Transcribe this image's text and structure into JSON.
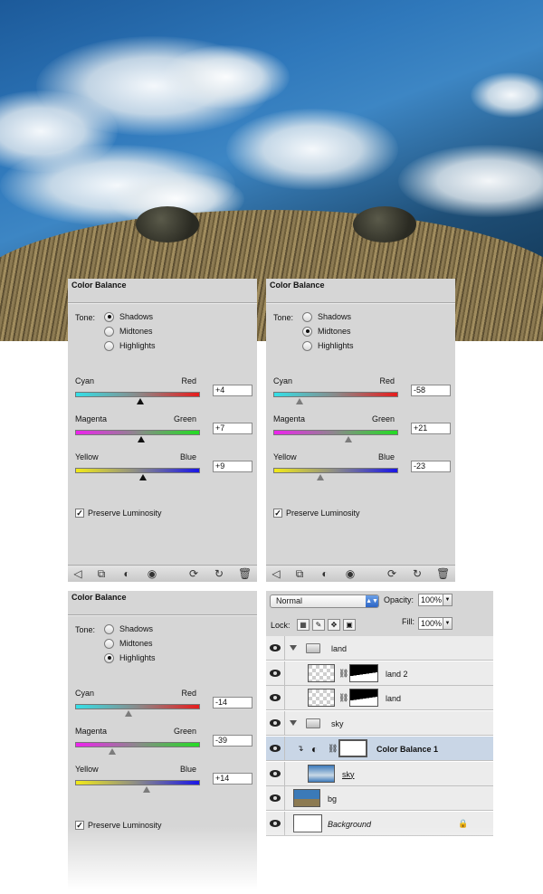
{
  "panels": [
    {
      "title": "Color Balance",
      "tone_label": "Tone:",
      "tones": [
        "Shadows",
        "Midtones",
        "Highlights"
      ],
      "selected_tone": 0,
      "sliders": [
        {
          "left": "Cyan",
          "right": "Red",
          "value": "+4",
          "pos": 0.52,
          "colors": [
            "#33e0e8",
            "#e81c1c"
          ]
        },
        {
          "left": "Magenta",
          "right": "Green",
          "value": "+7",
          "pos": 0.53,
          "colors": [
            "#ee22ee",
            "#22dd22"
          ]
        },
        {
          "left": "Yellow",
          "right": "Blue",
          "value": "+9",
          "pos": 0.54,
          "colors": [
            "#f2ea18",
            "#1a16e8"
          ]
        }
      ],
      "preserve": "Preserve Luminosity"
    },
    {
      "title": "Color Balance",
      "tone_label": "Tone:",
      "tones": [
        "Shadows",
        "Midtones",
        "Highlights"
      ],
      "selected_tone": 1,
      "sliders": [
        {
          "left": "Cyan",
          "right": "Red",
          "value": "-58",
          "pos": 0.21,
          "colors": [
            "#33e0e8",
            "#e81c1c"
          ]
        },
        {
          "left": "Magenta",
          "right": "Green",
          "value": "+21",
          "pos": 0.6,
          "colors": [
            "#ee22ee",
            "#22dd22"
          ]
        },
        {
          "left": "Yellow",
          "right": "Blue",
          "value": "-23",
          "pos": 0.38,
          "colors": [
            "#f2ea18",
            "#1a16e8"
          ]
        }
      ],
      "preserve": "Preserve Luminosity"
    },
    {
      "title": "Color Balance",
      "tone_label": "Tone:",
      "tones": [
        "Shadows",
        "Midtones",
        "Highlights"
      ],
      "selected_tone": 2,
      "sliders": [
        {
          "left": "Cyan",
          "right": "Red",
          "value": "-14",
          "pos": 0.43,
          "colors": [
            "#33e0e8",
            "#e81c1c"
          ]
        },
        {
          "left": "Magenta",
          "right": "Green",
          "value": "-39",
          "pos": 0.3,
          "colors": [
            "#ee22ee",
            "#22dd22"
          ]
        },
        {
          "left": "Yellow",
          "right": "Blue",
          "value": "+14",
          "pos": 0.57,
          "colors": [
            "#f2ea18",
            "#1a16e8"
          ]
        }
      ],
      "preserve": "Preserve Luminosity"
    }
  ],
  "footer_icons": [
    "back-arrow-icon",
    "clip-to-layer-icon",
    "view-previous-icon",
    "visibility-eye-icon",
    "reset-icon",
    "refresh-icon",
    "trash-icon"
  ],
  "layers_panel": {
    "blend_mode": "Normal",
    "opacity_label": "Opacity:",
    "opacity_value": "100%",
    "lock_label": "Lock:",
    "fill_label": "Fill:",
    "fill_value": "100%",
    "layers": [
      {
        "name": "land",
        "kind": "group",
        "indent": 0
      },
      {
        "name": "land 2",
        "kind": "masked",
        "indent": 1
      },
      {
        "name": "land",
        "kind": "masked",
        "indent": 1
      },
      {
        "name": "sky",
        "kind": "group",
        "indent": 0
      },
      {
        "name": "Color Balance 1",
        "kind": "adjustment",
        "indent": 1,
        "selected": true
      },
      {
        "name": "sky",
        "kind": "image",
        "indent": 1
      },
      {
        "name": "bg",
        "kind": "image",
        "indent": 0
      },
      {
        "name": "Background",
        "kind": "background",
        "indent": 0
      }
    ]
  }
}
